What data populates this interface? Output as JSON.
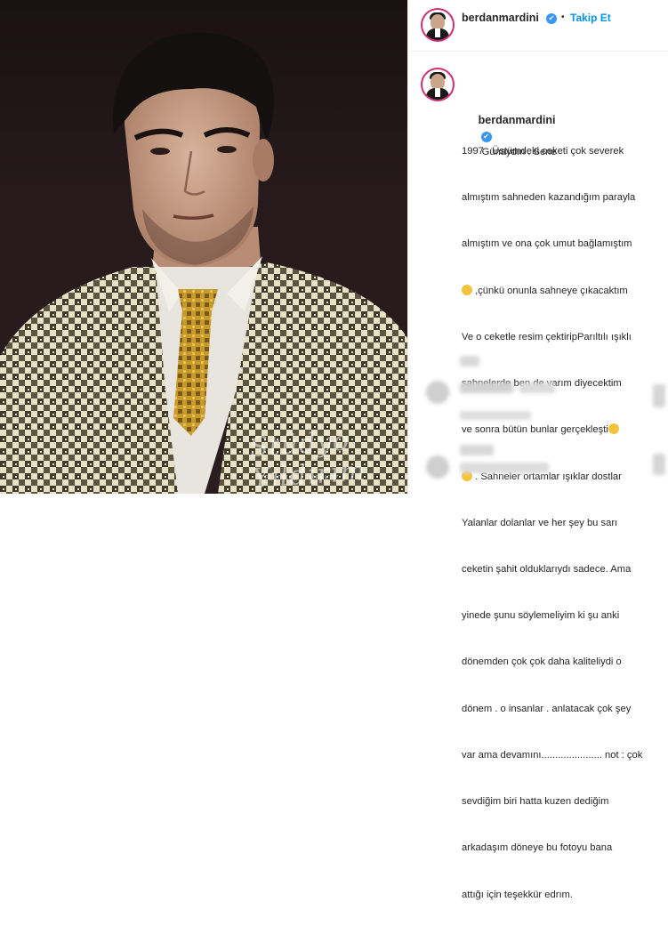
{
  "post": {
    "username": "berdanmardini",
    "follow_label": "Takip Et",
    "dot": "•",
    "verified_icon": "✔",
    "caption_text": "Günaydın . Sene 1997 . Üstümdeki ceketi çok severek almıştım sahneden kazandığım parayla almıştım ve ona çok umut bağlamıştım",
    "caption_lines": [
      "Günaydın . Sene",
      "1997 . Üstümdeki ceketi çok severek",
      "almıştım sahneden kazandığım parayla",
      "almıştım ve ona çok umut bağlamıştım",
      " ,çünkü onunla sahneye çıkacaktım",
      "Ve o ceketle resim çektiripParıltılı ışıklı",
      "sahnelerde ben de varım diyecektim",
      "ve sonra bütün bunlar gerçekleşti",
      " . Sahneler ortamlar ışıklar dostlar",
      "Yalanlar dolanlar ve her şey bu sarı",
      "ceketin şahit olduklarıydı sadece. Ama",
      "yinede şunu söylemeliyim ki şu anki",
      "dönemden çok çok daha kaliteliydi o",
      "dönem . o insanlar . anlatacak çok şey",
      "var ama devamını...................... not : çok",
      "sevdiğim biri hatta kuzen dediğim",
      "arkadaşım döneye bu fotoyu bana",
      "attığı için teşekkür edrım."
    ]
  },
  "photo": {
    "watermark": "Stüdyo Yıldırım",
    "watermark_sub": "TEL: 0 482 ... MERKEZ"
  },
  "colors": {
    "link": "#0095f6",
    "verified": "#3897f0",
    "text": "#262626",
    "border": "#efefef"
  }
}
